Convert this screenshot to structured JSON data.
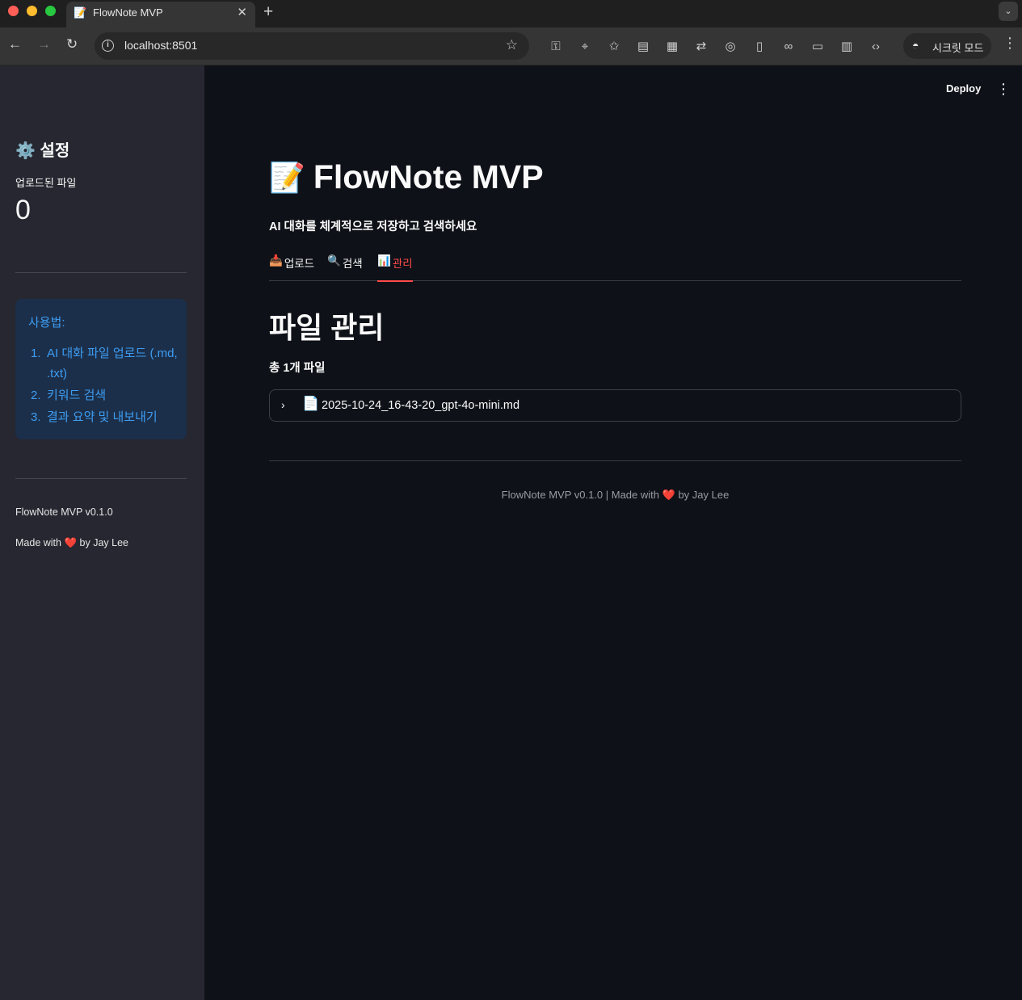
{
  "browser": {
    "tab_title": "FlowNote MVP",
    "tab_favicon": "📝",
    "url": "localhost:8501",
    "incognito_label": "시크릿 모드",
    "extension_icons": [
      "key-icon",
      "location-pin-icon",
      "star-plus-icon",
      "reader-icon",
      "qr-code-icon",
      "translate-icon",
      "lens-icon",
      "reading-mode-icon",
      "link-icon",
      "devices-icon",
      "panel-icon",
      "code-icon"
    ]
  },
  "header": {
    "deploy_label": "Deploy"
  },
  "sidebar": {
    "title": "⚙️ 설정",
    "metric_label": "업로드된 파일",
    "metric_value": "0",
    "info_title": "사용법:",
    "info_items": [
      {
        "num": "1.",
        "text": "AI 대화 파일 업로드 (.md, .txt)"
      },
      {
        "num": "2.",
        "text": "키워드 검색"
      },
      {
        "num": "3.",
        "text": "결과 요약 및 내보내기"
      }
    ],
    "footer_version": "FlowNote MVP v0.1.0",
    "footer_made_prefix": "Made with",
    "footer_heart": "❤️",
    "footer_made_suffix": "by Jay Lee"
  },
  "main": {
    "title_emoji": "📝",
    "title": "FlowNote MVP",
    "subtitle": "AI 대화를 체계적으로 저장하고 검색하세요",
    "tabs": [
      {
        "icon": "📥",
        "label": "업로드",
        "active": false
      },
      {
        "icon": "🔍",
        "label": "검색",
        "active": false
      },
      {
        "icon": "📊",
        "label": "관리",
        "active": true
      }
    ],
    "section_title": "파일 관리",
    "file_count": "총 1개 파일",
    "files": [
      {
        "icon": "📄",
        "name": "2025-10-24_16-43-20_gpt-4o-mini.md"
      }
    ],
    "footer_prefix": "FlowNote MVP v0.1.0 | Made with",
    "footer_heart": "❤️",
    "footer_suffix": "by Jay Lee"
  },
  "colors": {
    "accent": "#ff4b4b",
    "info_text": "#3d9df3",
    "info_bg": "#1c2f4a",
    "sidebar_bg": "#262730",
    "main_bg": "#0e1117"
  }
}
